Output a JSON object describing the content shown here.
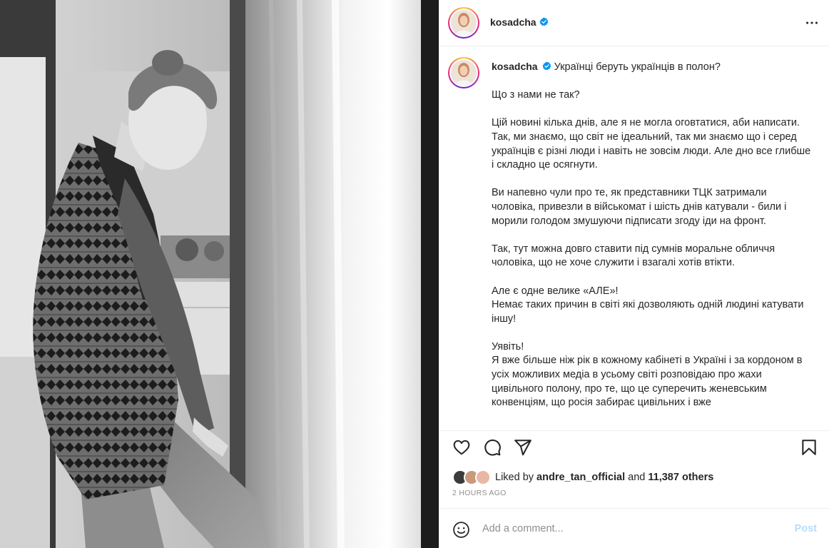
{
  "post": {
    "author": "kosadcha",
    "caption": {
      "author": "kosadcha",
      "text": " Українці беруть українців в полон?\n\nЩо з нами не так?\n\nЦій новині кілька днів, але я не могла оговтатися, аби написати.\nТак, ми знаємо, що світ не ідеальний, так ми знаємо що і серед українців є різні люди і навіть не зовсім люди. Але дно все глибше і складно це осягнути.\n\nВи напевно чули про те, як представники ТЦК затримали чоловіка, привезли в військомат і шість днів катували - били і морили голодом змушуючи підписати згоду іди на фронт.\n\nТак, тут можна довго ставити під сумнів моральне обличчя чоловіка, що не хоче служити і взагалі хотів втікти.\n\nАле є одне велике «АЛЕ»!\nНемає таких причин в світі які дозволяють одній людині катувати іншу!\n\nУявіть!\nЯ вже більше ніж рік в кожному кабінеті в Україні і за кордоном в усіх можливих медіа в усьому світі розповідаю про жахи цивільного полону, про те, що це суперечить женевським конвенціям, що росія забирає цивільних і вже"
    },
    "likes": {
      "prefix": "Liked by ",
      "first_liker": "andre_tan_official",
      "middle": " and ",
      "count": "11,387 others"
    },
    "timestamp": "2 HOURS AGO",
    "comment": {
      "placeholder": "Add a comment...",
      "post_label": "Post"
    }
  },
  "colors": {
    "verified": "#0095f6",
    "post_disabled": "#b9dcfc",
    "muted": "#8e8e8e"
  },
  "icons": [
    "verified-badge-icon",
    "more-options-icon",
    "heart-icon",
    "comment-icon",
    "share-icon",
    "bookmark-icon",
    "emoji-icon"
  ]
}
